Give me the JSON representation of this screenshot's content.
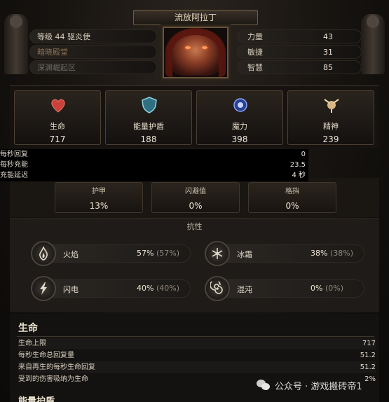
{
  "header": {
    "character_name": "流放阿拉丁",
    "level_prefix": "等级",
    "level": "44",
    "class_name": "驱炎使",
    "line2": "暗晓殿堂",
    "line3": "深渊崛起区"
  },
  "attributes": [
    {
      "label": "力量",
      "value": "43"
    },
    {
      "label": "敏捷",
      "value": "31"
    },
    {
      "label": "智慧",
      "value": "85"
    }
  ],
  "stats": [
    {
      "label": "生命",
      "value": "717",
      "icon": "heart-icon",
      "color": "#c9413a"
    },
    {
      "label": "能量护盾",
      "value": "188",
      "icon": "shield-icon",
      "color": "#6fb7c9"
    },
    {
      "label": "魔力",
      "value": "398",
      "icon": "mana-icon",
      "color": "#5a77d6"
    },
    {
      "label": "精神",
      "value": "239",
      "icon": "spirit-icon",
      "color": "#d7b784"
    }
  ],
  "recovery": [
    {
      "label": "每秒回复",
      "value": "0"
    },
    {
      "label": "每秒充能",
      "value": "23.5"
    },
    {
      "label": "充能延迟",
      "value": "4 秒"
    }
  ],
  "defense": [
    {
      "label": "护甲",
      "value": "13%"
    },
    {
      "label": "闪避值",
      "value": "0%"
    },
    {
      "label": "格挡",
      "value": "0%"
    }
  ],
  "resistance": {
    "title": "抗性",
    "items": [
      {
        "label": "火焰",
        "value": "57%",
        "cap": "(57%)",
        "icon": "fire-icon"
      },
      {
        "label": "冰霜",
        "value": "38%",
        "cap": "(38%)",
        "icon": "snowflake-icon"
      },
      {
        "label": "闪电",
        "value": "40%",
        "cap": "(40%)",
        "icon": "lightning-icon"
      },
      {
        "label": "混沌",
        "value": "0%",
        "cap": "(0%)",
        "icon": "chaos-icon"
      }
    ]
  },
  "life": {
    "title": "生命",
    "rows": [
      {
        "label": "生命上限",
        "value": "717"
      },
      {
        "label": "每秒生命总回复量",
        "value": "51.2"
      },
      {
        "label": "来自再生的每秒生命回复",
        "value": "51.2"
      },
      {
        "label": "受到的伤害吸纳为生命",
        "value": "2%"
      }
    ]
  },
  "next_section_title": "能量护盾",
  "watermark": "公众号 · 游戏搬砖帝1"
}
